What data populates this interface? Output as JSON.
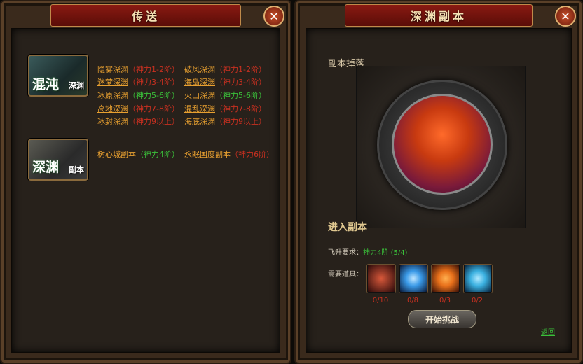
{
  "left_panel": {
    "title": "传送",
    "categories": [
      {
        "big": "混沌",
        "small": "深渊"
      },
      {
        "big": "深渊",
        "small": "副本"
      }
    ],
    "abyss_rows": [
      {
        "a": {
          "name": "隐雾深渊",
          "req": "（神力1-2阶）"
        },
        "b": {
          "name": "破风深渊",
          "req": "（神力1-2阶）"
        }
      },
      {
        "a": {
          "name": "迷梦深渊",
          "req": "（神力3-4阶）"
        },
        "b": {
          "name": "海岛深渊",
          "req": "（神力3-4阶）"
        }
      },
      {
        "a": {
          "name": "冰原深渊",
          "req": "（神力5-6阶）"
        },
        "b": {
          "name": "火山深渊",
          "req": "（神力5-6阶）"
        }
      },
      {
        "a": {
          "name": "高地深渊",
          "req": "（神力7-8阶）"
        },
        "b": {
          "name": "混乱深渊",
          "req": "（神力7-8阶）"
        }
      },
      {
        "a": {
          "name": "冰封深渊",
          "req": "（神力9以上）"
        },
        "b": {
          "name": "海底深渊",
          "req": "（神力9以上）"
        }
      }
    ],
    "dungeon_row": {
      "a": {
        "name": "树心城副本",
        "req": "（神力4阶）"
      },
      "b": {
        "name": "永眠国度副本",
        "req": "（神力6阶）"
      }
    }
  },
  "right_panel": {
    "title": "深渊副本",
    "drop_title": "副本掉落",
    "enter_label": "进入副本",
    "requirement_label": "飞升要求：",
    "requirement_value": "神力4阶",
    "requirement_progress": "(5/4)",
    "items_label": "需要道具：",
    "items": [
      {
        "name": "dark-orb-item-icon",
        "count": "0/10",
        "color": "#d8583a"
      },
      {
        "name": "blue-crystal-item-icon",
        "count": "0/8",
        "color": "#3a9ae8"
      },
      {
        "name": "fire-gem-item-icon",
        "count": "0/3",
        "color": "#e8701a"
      },
      {
        "name": "ice-shard-item-icon",
        "count": "0/2",
        "color": "#3ab0e0"
      }
    ],
    "start_button": "开始挑战",
    "back_link": "返回"
  },
  "colors": {
    "link": "#e8a030",
    "requirement_red": "#c83020",
    "requirement_green": "#3ac03a"
  }
}
